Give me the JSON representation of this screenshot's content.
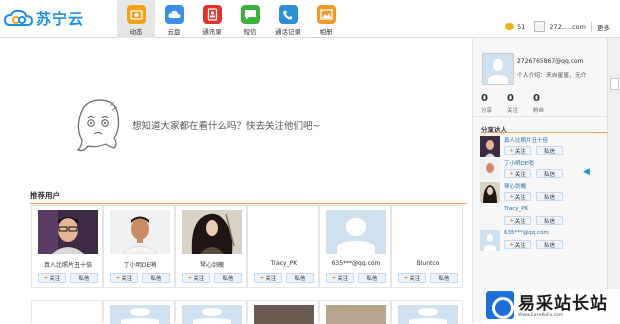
{
  "app": {
    "logo_text": "苏宁云"
  },
  "nav": [
    {
      "label": "动态",
      "icon": "feed-icon",
      "color": "#f4a21b",
      "active": true
    },
    {
      "label": "云盘",
      "icon": "cloud-icon",
      "color": "#3a8ee6",
      "active": false
    },
    {
      "label": "通讯录",
      "icon": "contacts-icon",
      "color": "#e0342a",
      "active": false
    },
    {
      "label": "短信",
      "icon": "sms-icon",
      "color": "#3cb33c",
      "active": false
    },
    {
      "label": "通话记录",
      "icon": "call-log-icon",
      "color": "#2b8fd6",
      "active": false
    },
    {
      "label": "相册",
      "icon": "album-icon",
      "color": "#f09a2a",
      "active": false
    }
  ],
  "topright": {
    "coins": "51",
    "account": "272.....com",
    "more": "更多"
  },
  "empty_state": {
    "text": "想知道大家都在看什么吗？快去关注他们吧~"
  },
  "recommended": {
    "title": "推荐用户",
    "follow_label": "关注",
    "message_label": "私信",
    "users": [
      {
        "name": "真人比照片丑十倍",
        "avatar": "glasses-man"
      },
      {
        "name": "丁小明DE哨",
        "avatar": "footballer"
      },
      {
        "name": "琴心剑魄",
        "avatar": "swordsman"
      },
      {
        "name": "Tracy_PK",
        "avatar": "blank"
      },
      {
        "name": "635***@qq.com",
        "avatar": "default"
      },
      {
        "name": "Bluntco",
        "avatar": "blank"
      }
    ]
  },
  "profile": {
    "id": "2726765867@qq.com",
    "intro": "个人介绍：来自星星，无介",
    "stats": [
      {
        "count": "0",
        "label": "分享"
      },
      {
        "count": "0",
        "label": "关注"
      },
      {
        "count": "0",
        "label": "粉丝"
      }
    ]
  },
  "experts": {
    "title": "分享达人",
    "users": [
      {
        "name": "真人比照片丑十倍",
        "avatar": "glasses-man"
      },
      {
        "name": "丁小明DE哨",
        "avatar": "footballer"
      },
      {
        "name": "琴心剑魄",
        "avatar": "swordsman"
      },
      {
        "name": "Tracy_PK",
        "avatar": "none"
      },
      {
        "name": "635***@qq.com",
        "avatar": "default"
      }
    ]
  },
  "watermark": {
    "text": "易采站长站",
    "url": "Www.EaseKeFo.com"
  }
}
